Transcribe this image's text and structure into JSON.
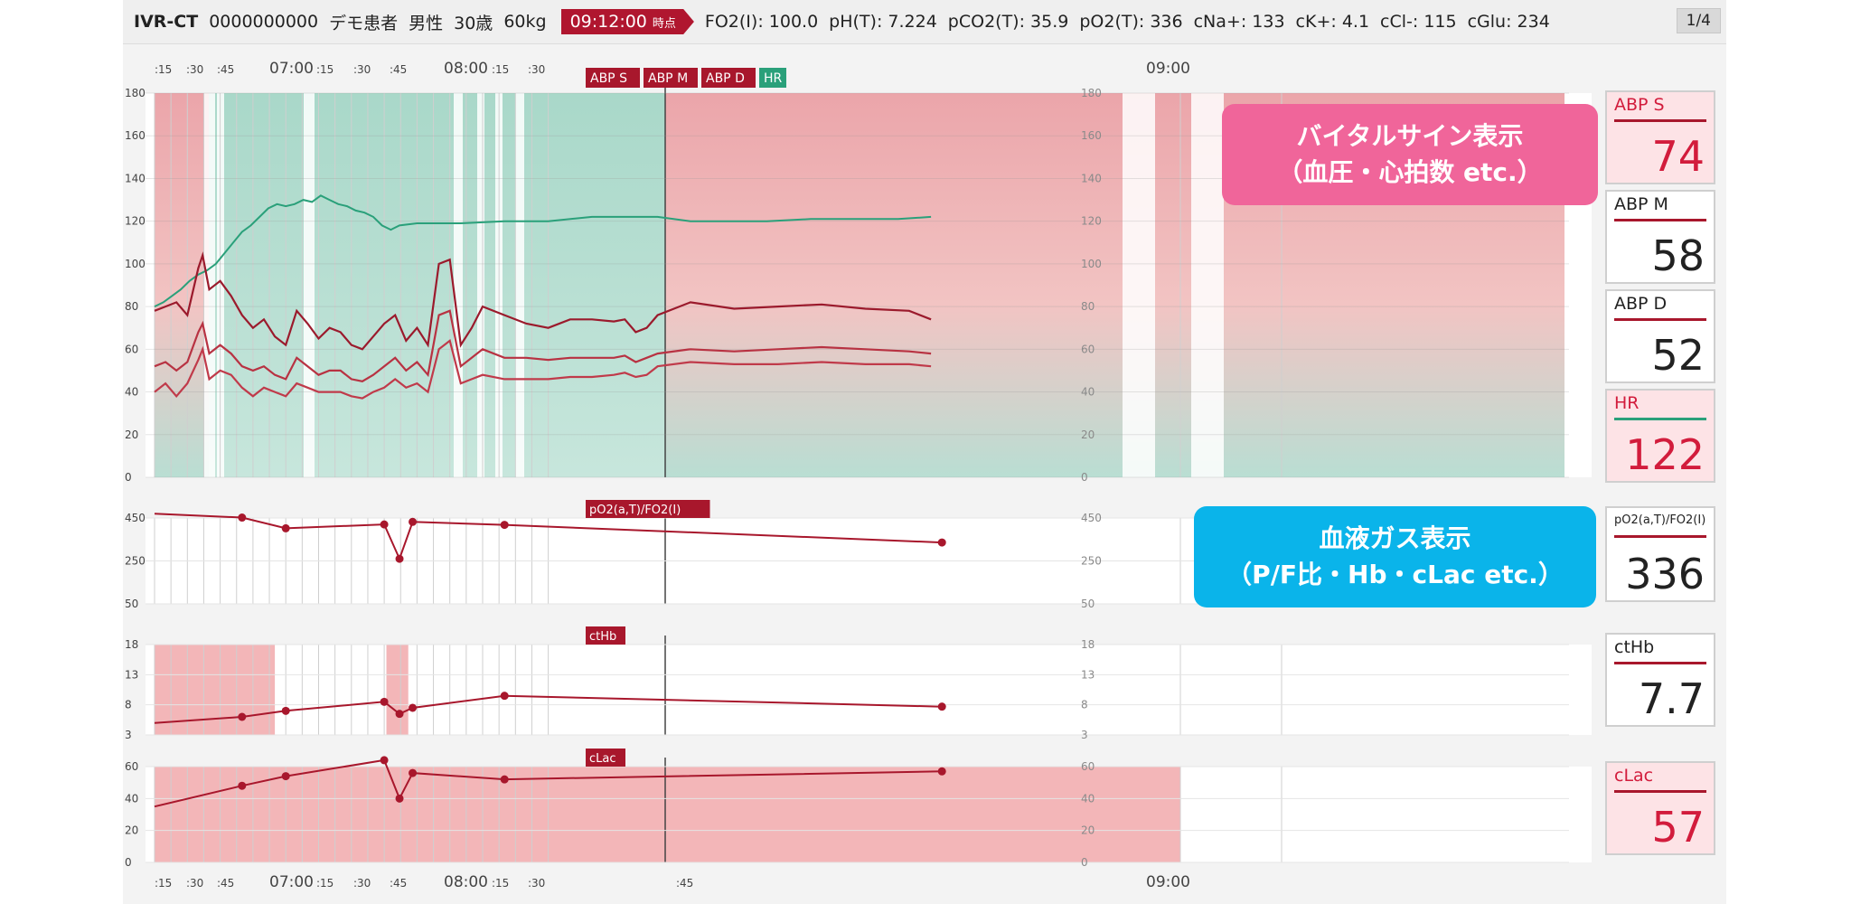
{
  "header": {
    "system_name": "IVR-CT",
    "patient_id": "0000000000",
    "patient_name": "デモ患者",
    "sex": "男性",
    "age": "30歳",
    "weight": "60kg",
    "time": "09:12:00",
    "time_suffix": "時点",
    "lab_values": [
      "FO2(I): 100.0",
      "pH(T): 7.224",
      "pCO2(T): 35.9",
      "pO2(T): 336",
      "cNa+: 133",
      "cK+: 4.1",
      "cCl-: 115",
      "cGlu: 234"
    ],
    "page_indicator": "1/4"
  },
  "time_axis": {
    "top_ticks": [
      ":15",
      ":30",
      ":45",
      "07:00",
      ":15",
      ":30",
      ":45",
      "08:00",
      ":15",
      ":30",
      "09:00"
    ],
    "bottom_ticks": [
      ":15",
      ":30",
      ":45",
      "07:00",
      ":15",
      ":30",
      ":45",
      "08:00",
      ":15",
      ":30",
      ":45",
      "09:00"
    ]
  },
  "colors": {
    "abp": "#a8172c",
    "hr": "#2aa07a",
    "alarm_red": "#f3b6b8",
    "normal_green": "#b3ddd0",
    "accent_pink": "#d21c3c",
    "callout_pink": "#f0659a",
    "callout_blue": "#0ab4ea"
  },
  "chart_data": [
    {
      "type": "line",
      "title": "",
      "legend": [
        "ABP S",
        "ABP M",
        "ABP D",
        "HR"
      ],
      "x_unit": "minutes after 06:00",
      "ylim": [
        0,
        180
      ],
      "yticks": [
        0,
        20,
        40,
        60,
        80,
        100,
        120,
        140,
        160,
        180
      ],
      "series": [
        {
          "name": "HR",
          "x": [
            0,
            4,
            8,
            12,
            16,
            20,
            24,
            28,
            32,
            36,
            40,
            44,
            48,
            52,
            56,
            60,
            64,
            68,
            72,
            76,
            80,
            84,
            88,
            92,
            96,
            100,
            104,
            108,
            112,
            120,
            140,
            160,
            180,
            200,
            230,
            245,
            260,
            280,
            300,
            340,
            355
          ],
          "y": [
            80,
            82,
            85,
            88,
            92,
            95,
            97,
            100,
            105,
            110,
            115,
            118,
            122,
            126,
            128,
            127,
            128,
            130,
            129,
            132,
            130,
            128,
            127,
            125,
            124,
            122,
            118,
            116,
            118,
            119,
            119,
            120,
            120,
            122,
            122,
            120,
            120,
            120,
            121,
            121,
            122
          ]
        },
        {
          "name": "ABP S",
          "x": [
            0,
            5,
            10,
            15,
            20,
            22,
            25,
            30,
            35,
            40,
            45,
            50,
            55,
            60,
            65,
            70,
            75,
            80,
            85,
            90,
            95,
            100,
            105,
            110,
            115,
            120,
            125,
            130,
            135,
            140,
            145,
            150,
            160,
            170,
            180,
            190,
            200,
            210,
            215,
            220,
            225,
            230,
            245,
            265,
            285,
            305,
            325,
            345,
            355
          ],
          "y": [
            78,
            80,
            82,
            76,
            98,
            104,
            88,
            92,
            85,
            76,
            70,
            74,
            66,
            62,
            78,
            72,
            65,
            70,
            68,
            62,
            60,
            66,
            72,
            76,
            64,
            70,
            62,
            100,
            102,
            62,
            70,
            80,
            76,
            72,
            70,
            74,
            74,
            73,
            74,
            68,
            70,
            76,
            82,
            79,
            80,
            81,
            79,
            78,
            74
          ]
        },
        {
          "name": "ABP M",
          "x": [
            0,
            5,
            10,
            15,
            20,
            22,
            25,
            30,
            35,
            40,
            45,
            50,
            55,
            60,
            65,
            70,
            75,
            80,
            85,
            90,
            95,
            100,
            105,
            110,
            115,
            120,
            125,
            130,
            135,
            140,
            145,
            150,
            160,
            170,
            180,
            190,
            200,
            210,
            215,
            220,
            225,
            230,
            245,
            265,
            285,
            305,
            325,
            345,
            355
          ],
          "y": [
            52,
            54,
            50,
            54,
            68,
            72,
            58,
            62,
            58,
            52,
            50,
            52,
            48,
            46,
            56,
            52,
            48,
            50,
            50,
            46,
            45,
            48,
            52,
            56,
            50,
            54,
            48,
            76,
            78,
            52,
            56,
            60,
            56,
            56,
            55,
            56,
            56,
            56,
            57,
            54,
            56,
            58,
            60,
            59,
            60,
            61,
            60,
            59,
            58
          ]
        },
        {
          "name": "ABP D",
          "x": [
            0,
            5,
            10,
            15,
            20,
            22,
            25,
            30,
            35,
            40,
            45,
            50,
            55,
            60,
            65,
            70,
            75,
            80,
            85,
            90,
            95,
            100,
            105,
            110,
            115,
            120,
            125,
            130,
            135,
            140,
            145,
            150,
            160,
            170,
            180,
            190,
            200,
            210,
            215,
            220,
            225,
            230,
            245,
            265,
            285,
            305,
            325,
            345,
            355
          ],
          "y": [
            40,
            44,
            38,
            44,
            55,
            60,
            46,
            50,
            48,
            42,
            38,
            42,
            40,
            38,
            44,
            42,
            40,
            40,
            40,
            38,
            37,
            40,
            42,
            46,
            42,
            44,
            40,
            60,
            64,
            44,
            46,
            48,
            46,
            46,
            46,
            47,
            47,
            48,
            49,
            47,
            48,
            52,
            54,
            53,
            53,
            54,
            53,
            53,
            52
          ]
        }
      ]
    },
    {
      "type": "line",
      "title": "pO2(a,T)/FO2(I)",
      "ylim": [
        50,
        450
      ],
      "yticks": [
        50,
        250,
        450
      ],
      "series": [
        {
          "name": "pO2(a,T)/FO2(I)",
          "x": [
            0,
            40,
            60,
            105,
            112,
            118,
            160,
            360
          ],
          "y": [
            470,
            452,
            402,
            420,
            260,
            432,
            418,
            336
          ]
        }
      ]
    },
    {
      "type": "line",
      "title": "ctHb",
      "ylim": [
        3,
        18
      ],
      "yticks": [
        3,
        8,
        13,
        18
      ],
      "series": [
        {
          "name": "ctHb",
          "x": [
            0,
            40,
            60,
            105,
            112,
            118,
            160,
            360
          ],
          "y": [
            5,
            6,
            7,
            8.5,
            6.5,
            7.5,
            9.5,
            7.7
          ]
        }
      ]
    },
    {
      "type": "line",
      "title": "cLac",
      "ylim": [
        0,
        60
      ],
      "yticks": [
        0,
        20,
        40,
        60
      ],
      "series": [
        {
          "name": "cLac",
          "x": [
            0,
            40,
            60,
            105,
            112,
            118,
            160,
            360
          ],
          "y": [
            35,
            48,
            54,
            64,
            40,
            56,
            52,
            57
          ]
        }
      ]
    }
  ],
  "tiles": [
    {
      "label": "ABP S",
      "value": "74",
      "alarm": true,
      "bar_color": "#a8172c"
    },
    {
      "label": "ABP M",
      "value": "58",
      "alarm": false,
      "bar_color": "#a8172c"
    },
    {
      "label": "ABP D",
      "value": "52",
      "alarm": false,
      "bar_color": "#a8172c"
    },
    {
      "label": "HR",
      "value": "122",
      "alarm": true,
      "bar_color": "#2aa07a"
    },
    {
      "label": "pO2(a,T)/FO2(I)",
      "value": "336",
      "alarm": false,
      "bar_color": "#a8172c"
    },
    {
      "label": "ctHb",
      "value": "7.7",
      "alarm": false,
      "bar_color": "#a8172c"
    },
    {
      "label": "cLac",
      "value": "57",
      "alarm": true,
      "bar_color": "#a8172c"
    }
  ],
  "callouts": {
    "vitals_line1": "バイタルサイン表示",
    "vitals_line2": "（血圧・心拍数 etc.）",
    "gas_line1": "血液ガス表示",
    "gas_line2": "（P/F比・Hb・cLac etc.）"
  }
}
